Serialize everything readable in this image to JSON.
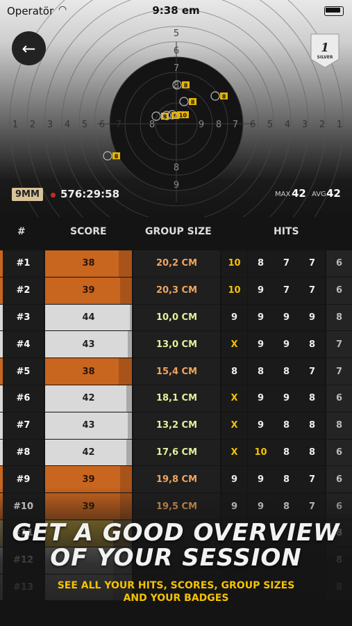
{
  "status_bar": {
    "carrier": "Operatör",
    "time": "9:38 em"
  },
  "header": {
    "badge_rank": "1",
    "badge_label": "SILVER",
    "caliber": "9MM",
    "timer": "576:29:58",
    "max_label": "MAX",
    "max_value": "42",
    "avg_label": "AVG",
    "avg_value": "42"
  },
  "target": {
    "ring_numbers_left": [
      "1",
      "2",
      "3",
      "4",
      "5",
      "6",
      "7",
      "8"
    ],
    "ring_numbers_right": [
      "9",
      "8",
      "7",
      "6",
      "5",
      "4",
      "3",
      "2",
      "1"
    ],
    "ring_numbers_top": [
      "5",
      "6",
      "7",
      "8"
    ],
    "ring_numbers_bottom": [
      "8",
      "9"
    ],
    "shot_markers": [
      "8",
      "8",
      "8",
      "9",
      "10",
      "8",
      "8"
    ]
  },
  "table": {
    "headers": {
      "num": "#",
      "score": "SCORE",
      "group": "GROUP SIZE",
      "hits": "HITS"
    },
    "rows": [
      {
        "num": "#1",
        "score": "38",
        "group": "20,2 CM",
        "hits": [
          "10",
          "8",
          "7",
          "7",
          "6"
        ],
        "tier": "orange"
      },
      {
        "num": "#2",
        "score": "39",
        "group": "20,3 CM",
        "hits": [
          "10",
          "9",
          "7",
          "7",
          "6"
        ],
        "tier": "orange"
      },
      {
        "num": "#3",
        "score": "44",
        "group": "10,0 CM",
        "hits": [
          "9",
          "9",
          "9",
          "9",
          "8"
        ],
        "tier": "silver"
      },
      {
        "num": "#4",
        "score": "43",
        "group": "13,0 CM",
        "hits": [
          "X",
          "9",
          "9",
          "8",
          "7"
        ],
        "tier": "silver"
      },
      {
        "num": "#5",
        "score": "38",
        "group": "15,4 CM",
        "hits": [
          "8",
          "8",
          "8",
          "7",
          "7"
        ],
        "tier": "orange"
      },
      {
        "num": "#6",
        "score": "42",
        "group": "18,1 CM",
        "hits": [
          "X",
          "9",
          "9",
          "8",
          "6"
        ],
        "tier": "silver"
      },
      {
        "num": "#7",
        "score": "43",
        "group": "13,2 CM",
        "hits": [
          "X",
          "9",
          "8",
          "8",
          "8"
        ],
        "tier": "silver"
      },
      {
        "num": "#8",
        "score": "42",
        "group": "17,6 CM",
        "hits": [
          "X",
          "10",
          "8",
          "8",
          "6"
        ],
        "tier": "silver"
      },
      {
        "num": "#9",
        "score": "39",
        "group": "19,8 CM",
        "hits": [
          "9",
          "9",
          "8",
          "7",
          "6"
        ],
        "tier": "orange"
      },
      {
        "num": "#10",
        "score": "39",
        "group": "19,5 CM",
        "hits": [
          "9",
          "9",
          "8",
          "7",
          "6"
        ],
        "tier": "orange"
      },
      {
        "num": "#11",
        "score": "",
        "group": "",
        "hits": [
          "",
          "",
          "",
          "",
          "8"
        ],
        "tier": "gold"
      },
      {
        "num": "#12",
        "score": "",
        "group": "",
        "hits": [
          "",
          "",
          "",
          "",
          "8"
        ],
        "tier": "silver"
      },
      {
        "num": "#13",
        "score": "",
        "group": "",
        "hits": [
          "",
          "",
          "",
          "",
          "8"
        ],
        "tier": "silver"
      }
    ]
  },
  "colors": {
    "orange": "#c8651f",
    "orange_dark": "#a8531a",
    "silver": "#d9d9d9",
    "silver_dark": "#a9a9a9",
    "gold_text": "#f5c200",
    "group_highlight": "#e6ef9a"
  },
  "promo": {
    "title_line1": "GET A GOOD OVERVIEW",
    "title_line2": "OF YOUR SESSION",
    "subtitle_line1": "SEE ALL YOUR HITS, SCORES, GROUP SIZES",
    "subtitle_line2": "AND YOUR BADGES"
  }
}
